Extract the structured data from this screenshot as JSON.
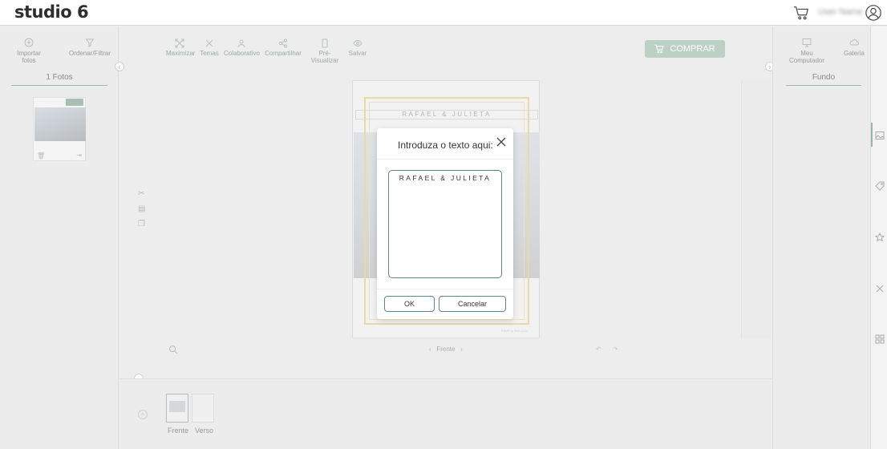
{
  "app": {
    "logo": "studio 6",
    "user_name": "User Name"
  },
  "left_panel": {
    "import_label": "Importar fotos",
    "sort_label": "Ordenar/Filtrar",
    "tab_label": "1 Fotos",
    "photo_count_badge": "1"
  },
  "toolbar": {
    "maximize": "Maximizar",
    "themes": "Temas",
    "collaborative": "Colaborativo",
    "share": "Compartilhar",
    "preview": "Pré-Visualizar",
    "save": "Salvar"
  },
  "buy_button": "COMPRAR",
  "canvas": {
    "title_text": "RAFAEL & JULIETA",
    "footer_text": "RSVP to 555-1234",
    "page_nav_label": "Frente",
    "undo_redo": "↶ ↷"
  },
  "bottom": {
    "pages": [
      {
        "label": "Frente"
      },
      {
        "label": "Verso"
      }
    ]
  },
  "right_panel": {
    "computer_label": "Meu Computador",
    "gallery_label": "Galeria",
    "tab_label": "Fundo"
  },
  "modal": {
    "title": "Introduza o texto aqui:",
    "text_value": "RAFAEL & JULIETA",
    "ok_label": "OK",
    "cancel_label": "Cancelar"
  },
  "colors": {
    "accent": "#5b8a77",
    "accent_light": "#bcd0c6",
    "gold": "#e8d9a8"
  }
}
